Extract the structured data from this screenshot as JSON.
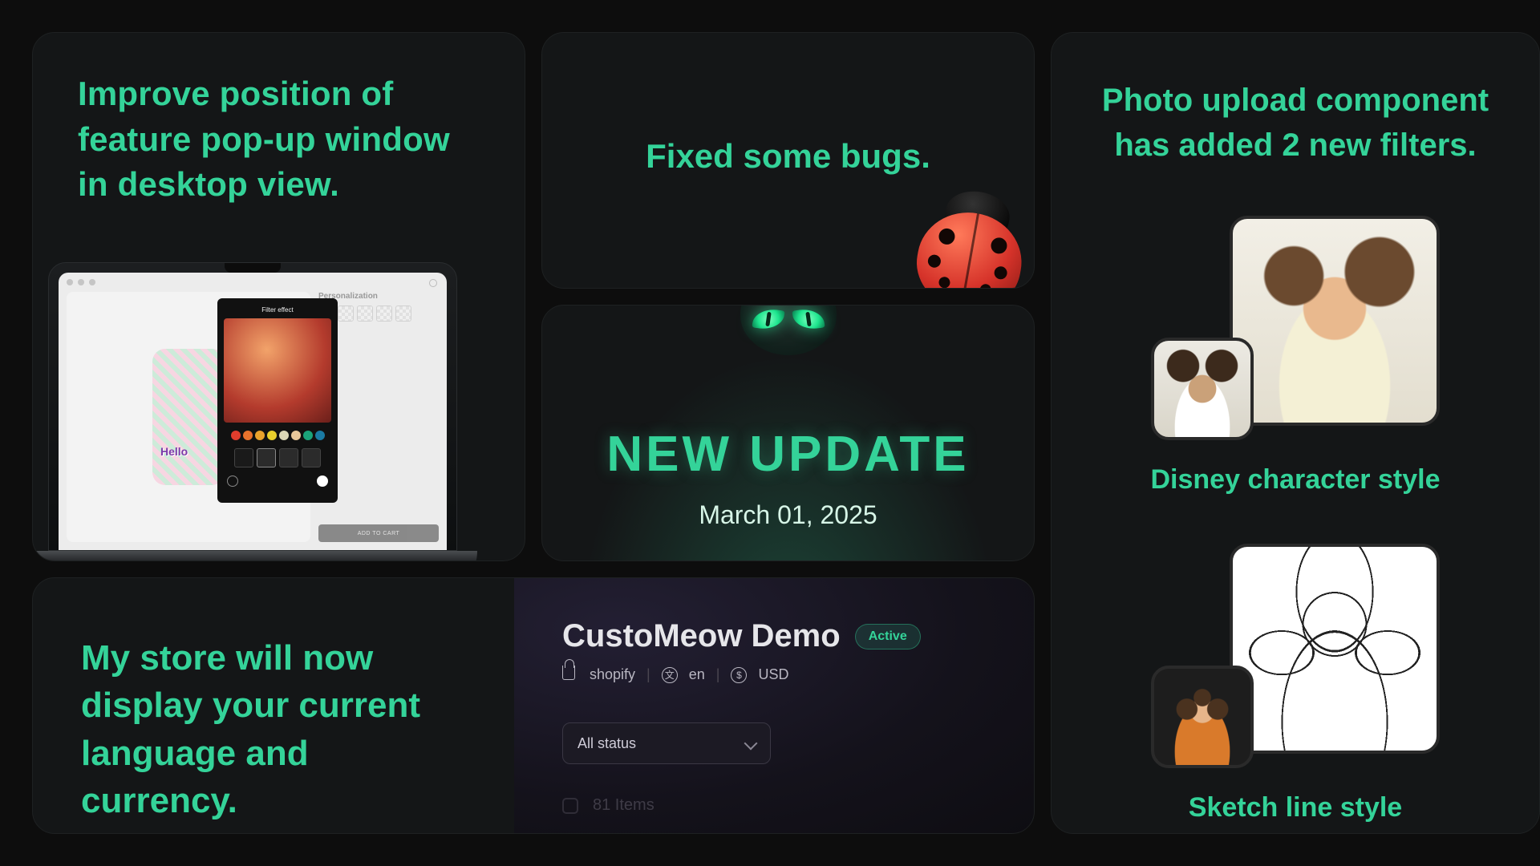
{
  "card_a": {
    "title": "Improve position of feature pop-up window in desktop view.",
    "mock": {
      "personalization_label": "Personalization",
      "filter_panel_title": "Filter effect",
      "product_text": "Hello",
      "add_to_cart": "ADD TO CART"
    }
  },
  "card_b": {
    "title": "Fixed some bugs."
  },
  "card_c": {
    "heading": "NEW UPDATE",
    "date": "March 01, 2025"
  },
  "card_d": {
    "title": "My store will now display your current language and currency.",
    "store_name": "CustoMeow Demo",
    "status_badge": "Active",
    "platform": "shopify",
    "language": "en",
    "currency": "USD",
    "status_filter": "All status",
    "items_count": "81 Items"
  },
  "card_e": {
    "title": "Photo upload component has added 2 new filters.",
    "filters": [
      {
        "label": "Disney character style"
      },
      {
        "label": "Sketch line style"
      }
    ]
  }
}
